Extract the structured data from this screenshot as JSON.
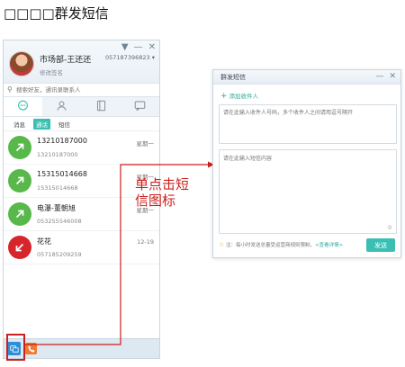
{
  "page": {
    "heading": "□□□□群发短信"
  },
  "panel": {
    "window_controls": [
      "▼",
      "—",
      "✕"
    ],
    "user": {
      "name": "市场部-王还还",
      "phone": "057187396823 ▾",
      "signature": "修改签名"
    },
    "search": {
      "placeholder": "搜索好友，通讯录联系人"
    },
    "main_tabs": [
      {
        "icon": "chat-bubble-icon"
      },
      {
        "icon": "person-icon"
      },
      {
        "icon": "address-book-icon"
      },
      {
        "icon": "message-window-icon"
      }
    ],
    "sub_tabs": [
      "消息",
      "通话",
      "短信"
    ],
    "contacts": [
      {
        "name": "13210187000",
        "number": "13210187000",
        "time": "星期一",
        "direction": "outgoing",
        "color": "#58b84a"
      },
      {
        "name": "15315014668",
        "number": "15315014668",
        "time": "星期一",
        "direction": "outgoing",
        "color": "#58b84a"
      },
      {
        "name": "电瀑-董朝旭",
        "number": "053255546008",
        "time": "星期一",
        "direction": "outgoing",
        "color": "#58b84a"
      },
      {
        "name": "花花",
        "number": "057185209259",
        "time": "12-19",
        "direction": "incoming",
        "color": "#d6262b"
      }
    ],
    "footer": {
      "sms_icon_color": "#2e8fd8",
      "call_icon_color": "#f07b2e"
    }
  },
  "annotation": {
    "text": "单点击短信图标",
    "color": "#cc1f1f"
  },
  "sms_window": {
    "title": "群发短信",
    "controls": [
      "—",
      "✕"
    ],
    "add_recipient": "添加收件人",
    "recipients_placeholder": "请在此输入收件人号码，多个收件人之间请用逗号隔开",
    "content_placeholder": "请在此输入短信内容",
    "char_count": "0",
    "note_prefix": "注：每小时发送总量受运营商规则限制，",
    "note_link": "<查看详情>",
    "send_label": "发送",
    "accent": "#3bbfb5"
  }
}
